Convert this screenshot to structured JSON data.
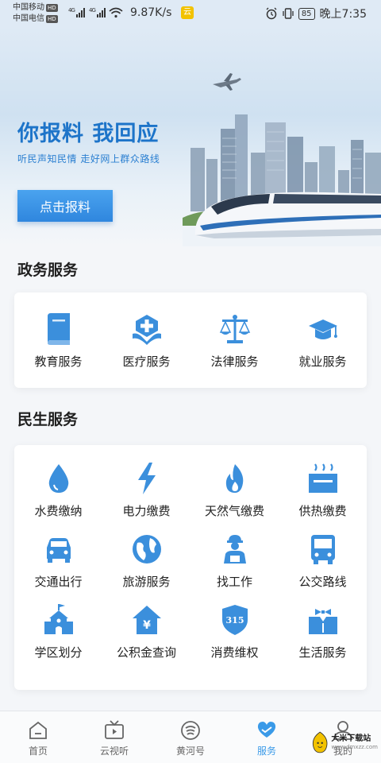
{
  "status_bar": {
    "carrier1": "中国移动",
    "carrier2": "中国电信",
    "hd": "HD",
    "network": "4G",
    "speed": "9.87K/s",
    "battery": "85",
    "time": "晚上7:35"
  },
  "banner": {
    "title": "你报料 我回应",
    "subtitle": "听民声知民情  走好网上群众路线",
    "button_label": "点击报料"
  },
  "gov_services": {
    "title": "政务服务",
    "items": [
      {
        "label": "教育服务",
        "icon": "book-icon"
      },
      {
        "label": "医疗服务",
        "icon": "medical-icon"
      },
      {
        "label": "法律服务",
        "icon": "scales-icon"
      },
      {
        "label": "就业服务",
        "icon": "graduation-cap-icon"
      }
    ]
  },
  "life_services": {
    "title": "民生服务",
    "items": [
      {
        "label": "水费缴纳",
        "icon": "water-drop-icon"
      },
      {
        "label": "电力缴费",
        "icon": "lightning-icon"
      },
      {
        "label": "天然气缴费",
        "icon": "flame-icon"
      },
      {
        "label": "供热缴费",
        "icon": "heater-icon"
      },
      {
        "label": "交通出行",
        "icon": "car-icon"
      },
      {
        "label": "旅游服务",
        "icon": "globe-icon"
      },
      {
        "label": "找工作",
        "icon": "worker-icon"
      },
      {
        "label": "公交路线",
        "icon": "bus-icon"
      },
      {
        "label": "学区划分",
        "icon": "school-icon"
      },
      {
        "label": "公积金查询",
        "icon": "fund-house-icon"
      },
      {
        "label": "消费维权",
        "icon": "shield-315-icon"
      },
      {
        "label": "生活服务",
        "icon": "butler-icon"
      }
    ],
    "shield_text": "315",
    "fund_symbol": "¥"
  },
  "bottom_nav": {
    "items": [
      {
        "label": "首页",
        "icon": "home-icon"
      },
      {
        "label": "云视听",
        "icon": "tv-icon"
      },
      {
        "label": "黄河号",
        "icon": "yellow-river-icon"
      },
      {
        "label": "服务",
        "icon": "heart-hand-icon",
        "active": true
      },
      {
        "label": "我的",
        "icon": "user-icon"
      }
    ]
  },
  "watermark": {
    "text": "大米下载站",
    "url": "www.dmxzz.com"
  },
  "colors": {
    "accent": "#3a9ae8",
    "icon_blue": "#3b8fdc",
    "title_blue": "#1d74c9"
  }
}
